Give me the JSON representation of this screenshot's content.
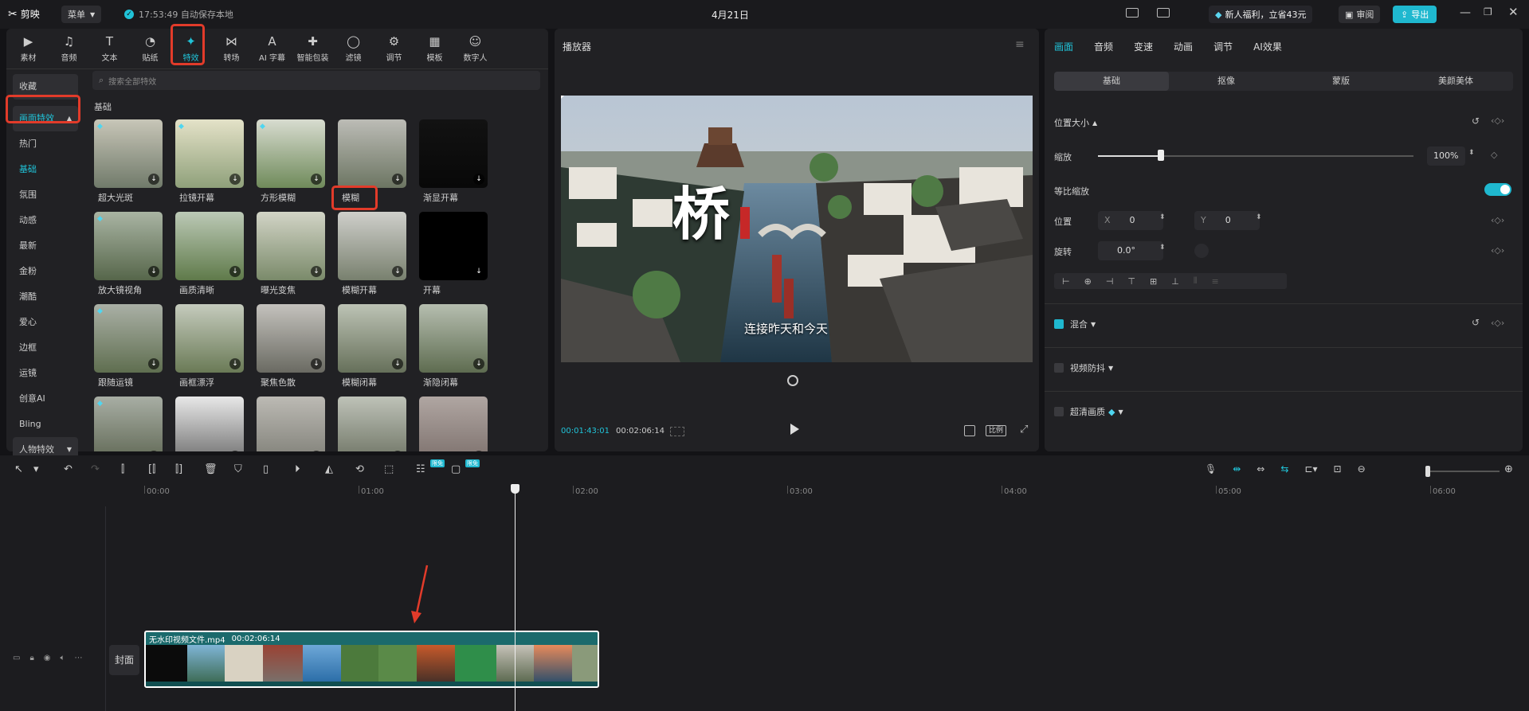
{
  "titlebar": {
    "app_name": "剪映",
    "menu_label": "菜单",
    "autosave": "17:53:49 自动保存本地",
    "date": "4月21日",
    "promo": "新人福利，立省43元",
    "review_label": "审阅",
    "export_label": "导出"
  },
  "toolbar": {
    "items": [
      {
        "label": "素材"
      },
      {
        "label": "音频"
      },
      {
        "label": "文本"
      },
      {
        "label": "贴纸"
      },
      {
        "label": "特效"
      },
      {
        "label": "转场"
      },
      {
        "label": "AI 字幕"
      },
      {
        "label": "智能包装"
      },
      {
        "label": "滤镜"
      },
      {
        "label": "调节"
      },
      {
        "label": "模板"
      },
      {
        "label": "数字人"
      }
    ]
  },
  "sidebar": {
    "favorites": "收藏",
    "screen_effects": "画面特效",
    "items": [
      "热门",
      "基础",
      "氛围",
      "动感",
      "最新",
      "金粉",
      "潮酷",
      "爱心",
      "边框",
      "运镜",
      "创意AI",
      "Bling"
    ],
    "person_effects": "人物特效"
  },
  "effects": {
    "search_placeholder": "搜索全部特效",
    "section_title": "基础",
    "items": [
      {
        "label": "超大光斑"
      },
      {
        "label": "拉镜开幕"
      },
      {
        "label": "方形模糊"
      },
      {
        "label": "模糊"
      },
      {
        "label": "渐显开幕"
      },
      {
        "label": "放大镜视角"
      },
      {
        "label": "画质清晰"
      },
      {
        "label": "曝光变焦"
      },
      {
        "label": "模糊开幕"
      },
      {
        "label": "开幕"
      },
      {
        "label": "跟随运镜"
      },
      {
        "label": "画框漂浮"
      },
      {
        "label": "聚焦色散"
      },
      {
        "label": "模糊闭幕"
      },
      {
        "label": "渐隐闭幕"
      },
      {
        "label": ""
      },
      {
        "label": ""
      },
      {
        "label": ""
      },
      {
        "label": ""
      },
      {
        "label": ""
      }
    ]
  },
  "player": {
    "title": "播放器",
    "video_caption": "连接昨天和今天",
    "calligraphy": "桥",
    "current_time": "00:01:43:01",
    "total_time": "00:02:06:14",
    "ratio_label": "比例"
  },
  "inspector": {
    "tabs": [
      "画面",
      "音频",
      "变速",
      "动画",
      "调节",
      "AI效果"
    ],
    "subtabs": [
      "基础",
      "抠像",
      "蒙版",
      "美颜美体"
    ],
    "position_size": "位置大小",
    "scale_label": "缩放",
    "scale_value": "100%",
    "scale_fraction": 0.2,
    "uniform_scale": "等比缩放",
    "position_label": "位置",
    "x_label": "X",
    "x_value": "0",
    "y_label": "Y",
    "y_value": "0",
    "rotate_label": "旋转",
    "rotate_value": "0.0°",
    "blend_label": "混合",
    "stabilize_label": "视频防抖",
    "hq_label": "超清画质"
  },
  "timeline": {
    "badge_free": "限免",
    "ticks": [
      "00:00",
      "01:00",
      "02:00",
      "03:00",
      "04:00",
      "05:00",
      "06:00"
    ],
    "cover_label": "封面",
    "clip_name": "无水印视频文件.mp4",
    "clip_duration": "00:02:06:14",
    "playhead_time_seconds": 103
  },
  "colors": {
    "accent": "#20c3d8",
    "highlight_box": "#e23b2a",
    "clip_teal": "#1b6a6c"
  }
}
